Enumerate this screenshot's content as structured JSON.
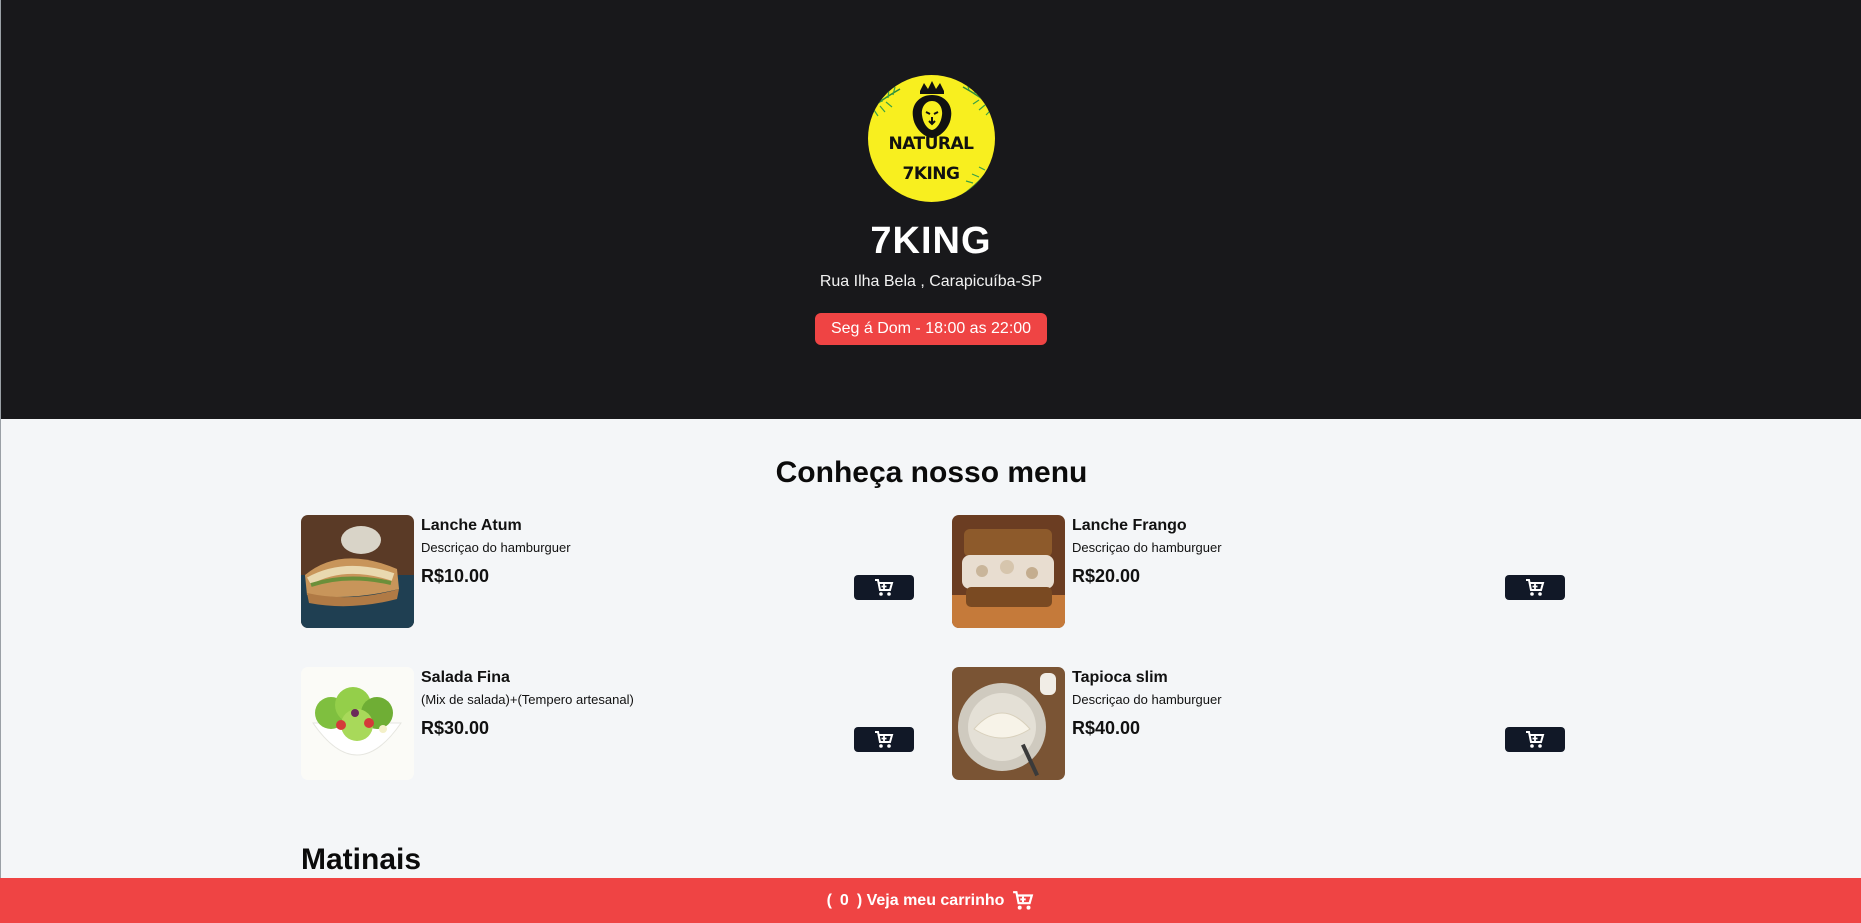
{
  "header": {
    "logo_line1": "NATURAL",
    "logo_line2": "7KING",
    "store_name": "7KING",
    "address": "Rua Ilha Bela , Carapicuíba-SP",
    "hours": "Seg á Dom - 18:00 as 22:00"
  },
  "menu": {
    "title": "Conheça nosso menu",
    "items": [
      {
        "name": "Lanche Atum",
        "description": "Descriçao do hamburguer",
        "price": "R$10.00",
        "image": "tuna-sandwich"
      },
      {
        "name": "Lanche Frango",
        "description": "Descriçao do hamburguer",
        "price": "R$20.00",
        "image": "chicken-sandwich"
      },
      {
        "name": "Salada Fina",
        "description": "(Mix de salada)+(Tempero artesanal)",
        "price": "R$30.00",
        "image": "salad-bowl"
      },
      {
        "name": "Tapioca slim",
        "description": "Descriçao do hamburguer",
        "price": "R$40.00",
        "image": "tapioca"
      }
    ]
  },
  "sections": {
    "next_title": "Matinais"
  },
  "cart": {
    "open_paren": "(",
    "count": "0",
    "label": ") Veja meu carrinho"
  },
  "colors": {
    "header_bg": "#18181b",
    "accent": "#ef4444",
    "button_dark": "#111827",
    "logo_yellow": "#f8ef1f"
  }
}
